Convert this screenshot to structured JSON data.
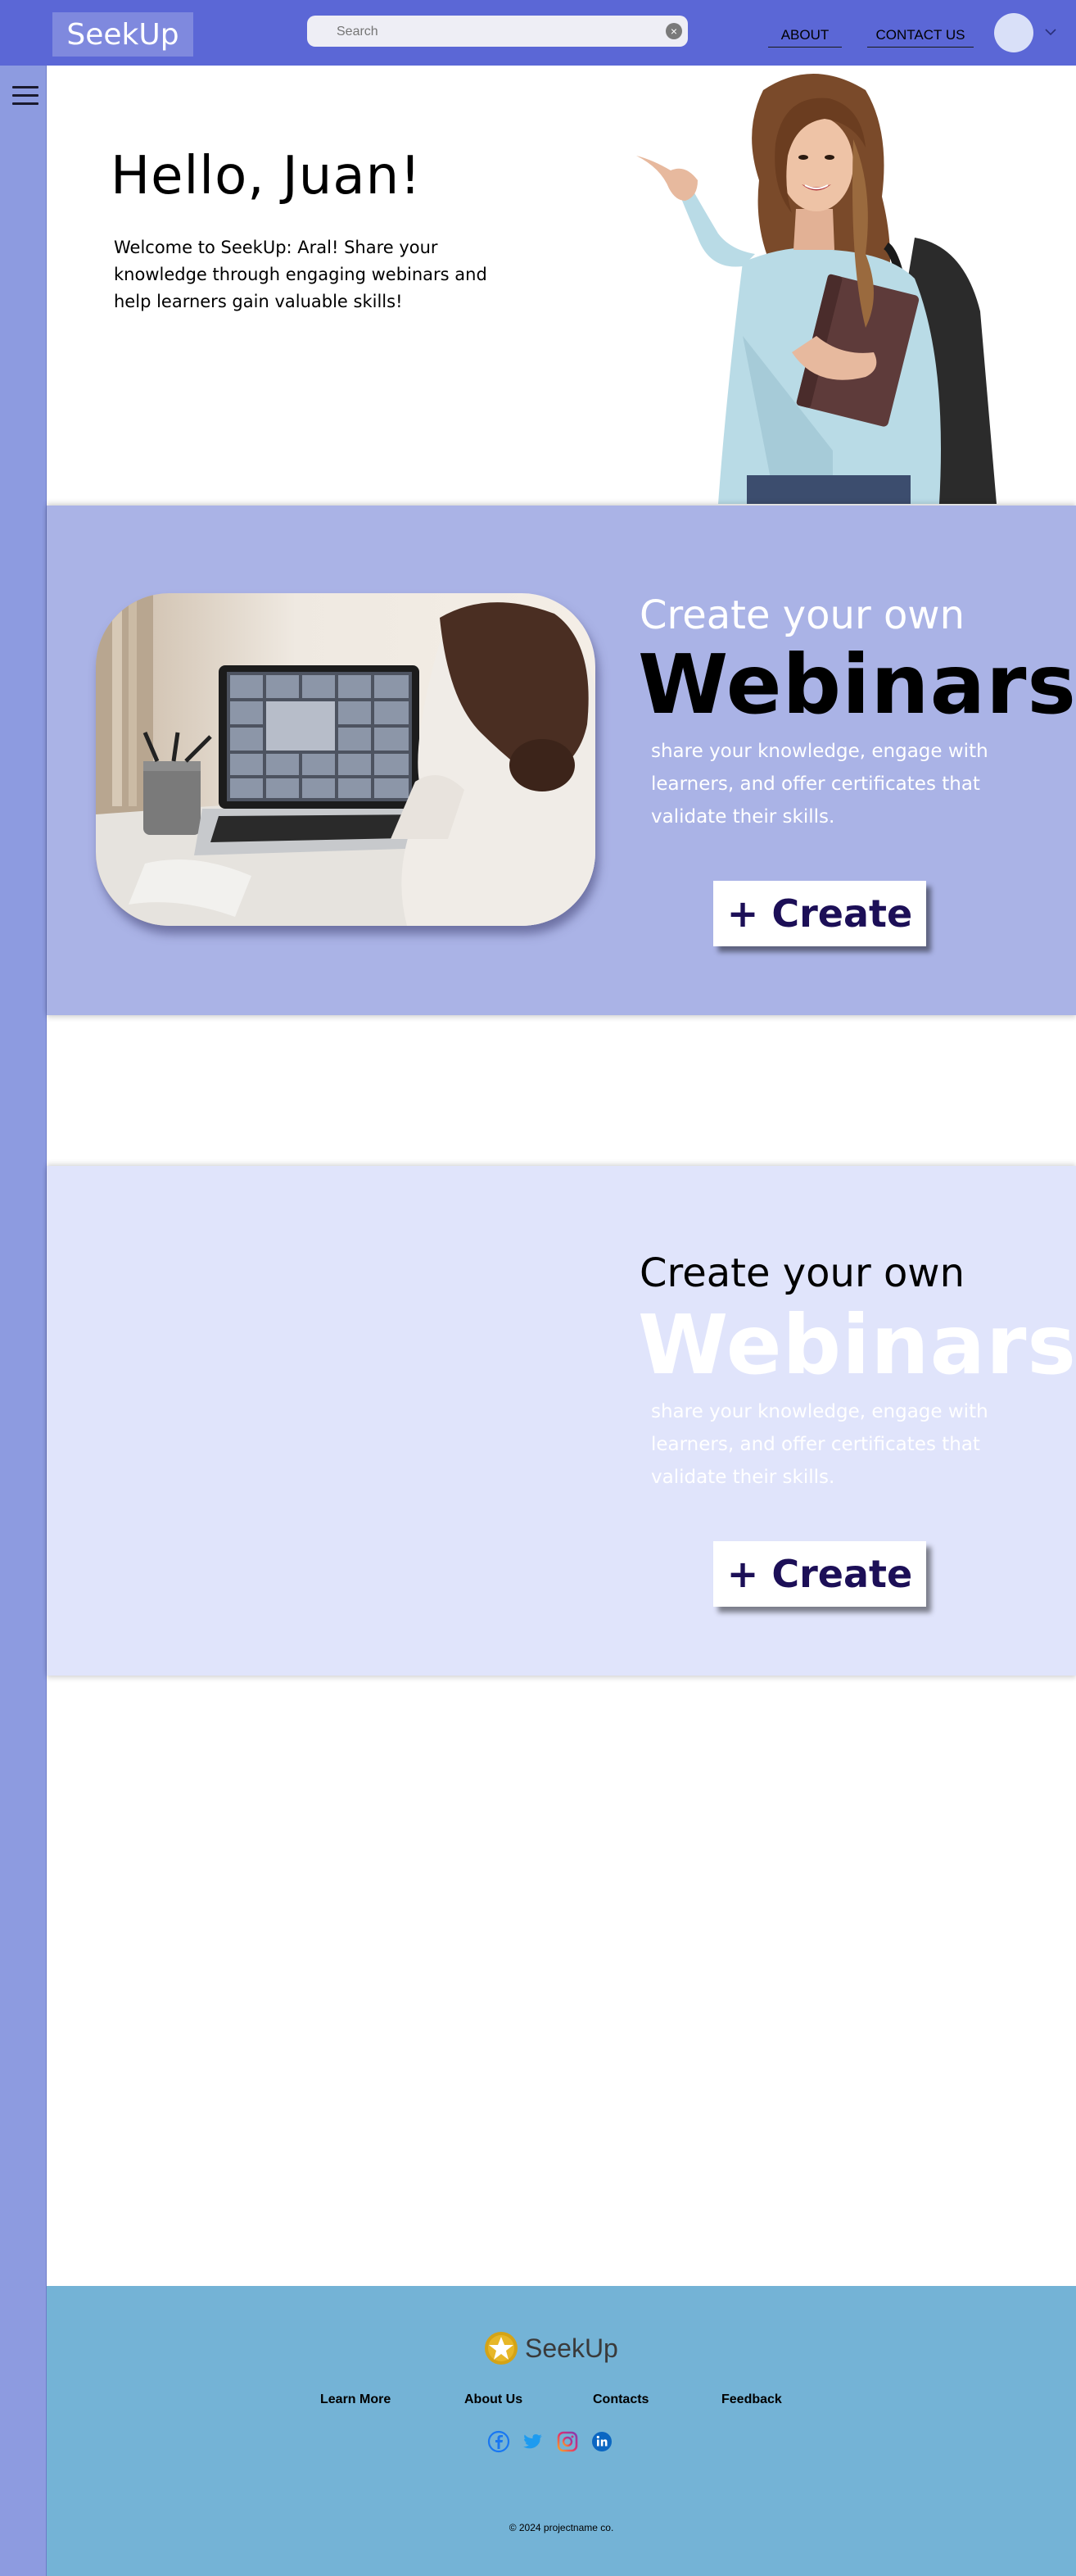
{
  "header": {
    "logo_text": "SeekUp",
    "search_placeholder": "Search",
    "nav": {
      "about": "ABOUT",
      "contact": "CONTACT US"
    }
  },
  "hero": {
    "greeting": "Hello, Juan!",
    "welcome_text": "Welcome to SeekUp: Aral! Share your knowledge through engaging webinars and help learners gain valuable skills!"
  },
  "section1": {
    "subtitle": "Create your own",
    "title": "Webinars",
    "description": "share your knowledge, engage with learners, and offer certificates that validate their skills.",
    "button_label": "+ Create"
  },
  "section2": {
    "subtitle": "Create your own",
    "title": "Webinars",
    "description": "share your knowledge, engage with learners, and offer certificates that validate their skills.",
    "button_label": "+ Create"
  },
  "footer": {
    "logo_text": "SeekUp",
    "links": [
      "Learn More",
      "About Us",
      "Contacts",
      "Feedback"
    ],
    "social_icons": [
      "facebook-icon",
      "twitter-icon",
      "instagram-icon",
      "linkedin-icon"
    ],
    "copyright": "© 2024 projectname co."
  },
  "colors": {
    "topbar": "#5b67d6",
    "sidebar": "#8d9be0",
    "section1_bg": "#aab3e6",
    "section2_bg": "#e0e4fb",
    "footer_bg": "#74b3d6",
    "button_text": "#1c0f57"
  }
}
